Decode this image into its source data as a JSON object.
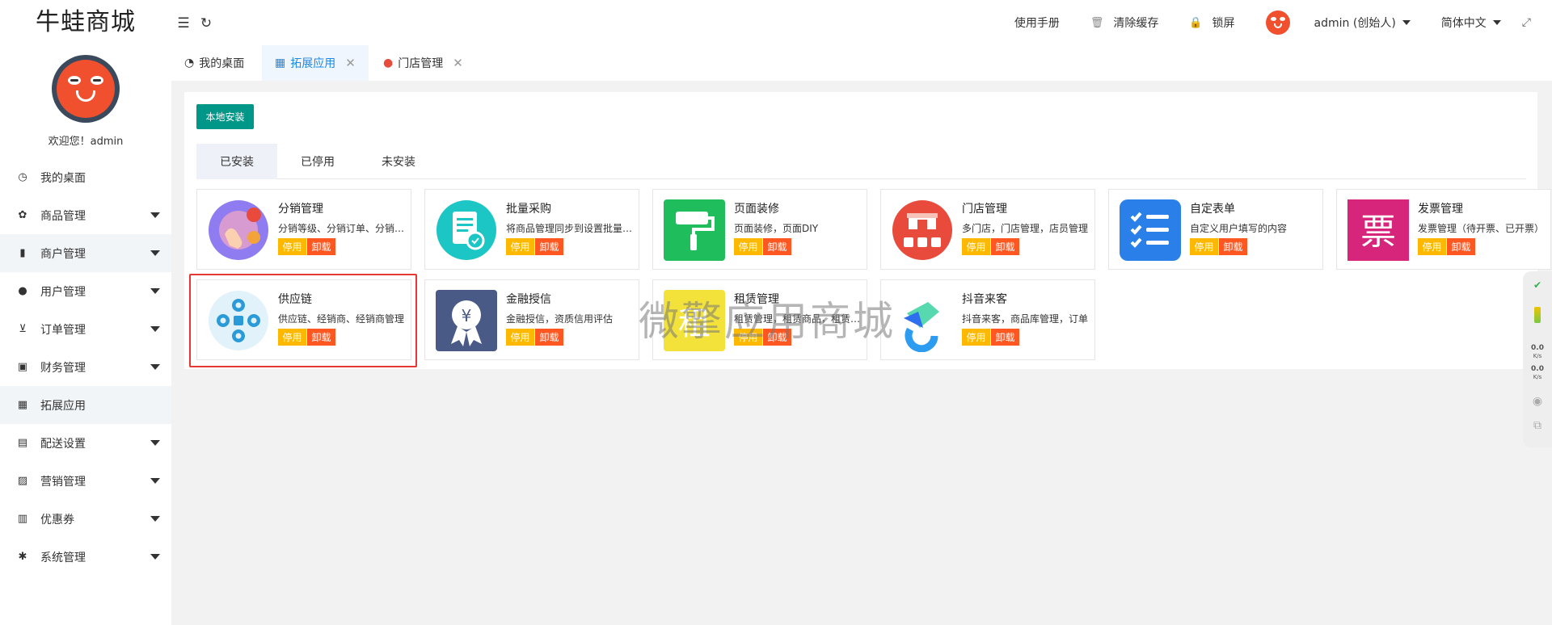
{
  "app": {
    "title": "牛蛙商城",
    "welcome": "欢迎您！admin"
  },
  "sidebar": {
    "items": [
      {
        "label": "我的桌面",
        "icon": "dashboard-icon",
        "glyph": "◷",
        "has_children": false
      },
      {
        "label": "商品管理",
        "icon": "goods-icon",
        "glyph": "✿",
        "has_children": true
      },
      {
        "label": "商户管理",
        "icon": "merchant-icon",
        "glyph": "▮",
        "has_children": true
      },
      {
        "label": "用户管理",
        "icon": "user-icon",
        "glyph": "●",
        "has_children": true
      },
      {
        "label": "订单管理",
        "icon": "cart-icon",
        "glyph": "⊻",
        "has_children": true
      },
      {
        "label": "财务管理",
        "icon": "money-icon",
        "glyph": "▣",
        "has_children": true
      },
      {
        "label": "拓展应用",
        "icon": "apps-icon",
        "glyph": "▦",
        "has_children": false
      },
      {
        "label": "配送设置",
        "icon": "truck-icon",
        "glyph": "▤",
        "has_children": true
      },
      {
        "label": "营销管理",
        "icon": "chart-icon",
        "glyph": "▨",
        "has_children": true
      },
      {
        "label": "优惠券",
        "icon": "coupon-icon",
        "glyph": "▥",
        "has_children": true
      },
      {
        "label": "系统管理",
        "icon": "gear-icon",
        "glyph": "✱",
        "has_children": true
      }
    ]
  },
  "header": {
    "manual": "使用手册",
    "clear_cache": "清除缓存",
    "lock": "锁屏",
    "user": "admin (创始人)",
    "language": "简体中文"
  },
  "tabs": [
    {
      "label": "我的桌面",
      "icon": "gauge-icon",
      "active": false,
      "closable": false
    },
    {
      "label": "拓展应用",
      "icon": "grid-icon",
      "active": true,
      "closable": true
    },
    {
      "label": "门店管理",
      "icon": "frog-icon",
      "active": false,
      "closable": true
    }
  ],
  "main": {
    "install_button": "本地安装",
    "subtabs": [
      "已安装",
      "已停用",
      "未安装"
    ],
    "disable_label": "停用",
    "uninstall_label": "卸载",
    "apps": [
      {
        "name": "分销管理",
        "desc": "分销等级、分销订单、分销商管理",
        "icon": "distribution-icon",
        "color": "#8e7cf0"
      },
      {
        "name": "批量采购",
        "desc": "将商品管理同步到设置批量采购",
        "icon": "purchase-icon",
        "color": "#1bc6c4"
      },
      {
        "name": "页面装修",
        "desc": "页面装修，页面DIY",
        "icon": "paint-roller-icon",
        "color": "#1fbd5c"
      },
      {
        "name": "门店管理",
        "desc": "多门店，门店管理，店员管理",
        "icon": "store-icon",
        "color": "#e84b3c"
      },
      {
        "name": "自定表单",
        "desc": "自定义用户填写的内容",
        "icon": "checklist-icon",
        "color": "#2b7fe8"
      },
      {
        "name": "发票管理",
        "desc": "发票管理（待开票、已开票）",
        "icon": "invoice-icon",
        "color": "#d6257a"
      },
      {
        "name": "供应链",
        "desc": "供应链、经销商、经销商管理",
        "icon": "supply-chain-icon",
        "color": "#2a9bd8"
      },
      {
        "name": "金融授信",
        "desc": "金融授信，资质信用评估",
        "icon": "yuan-badge-icon",
        "color": "#4a5a86"
      },
      {
        "name": "租赁管理",
        "desc": "租赁管理，租赁商品，租赁订单",
        "icon": "rent-icon",
        "color": "#f2e23a"
      },
      {
        "name": "抖音来客",
        "desc": "抖音来客，商品库管理，订单",
        "icon": "douyin-icon",
        "color": "#2e6ff0"
      }
    ]
  },
  "watermark": "微擎应用商城",
  "widget": {
    "speed_up": "0.0",
    "speed_down": "0.0",
    "unit": "K/s"
  }
}
